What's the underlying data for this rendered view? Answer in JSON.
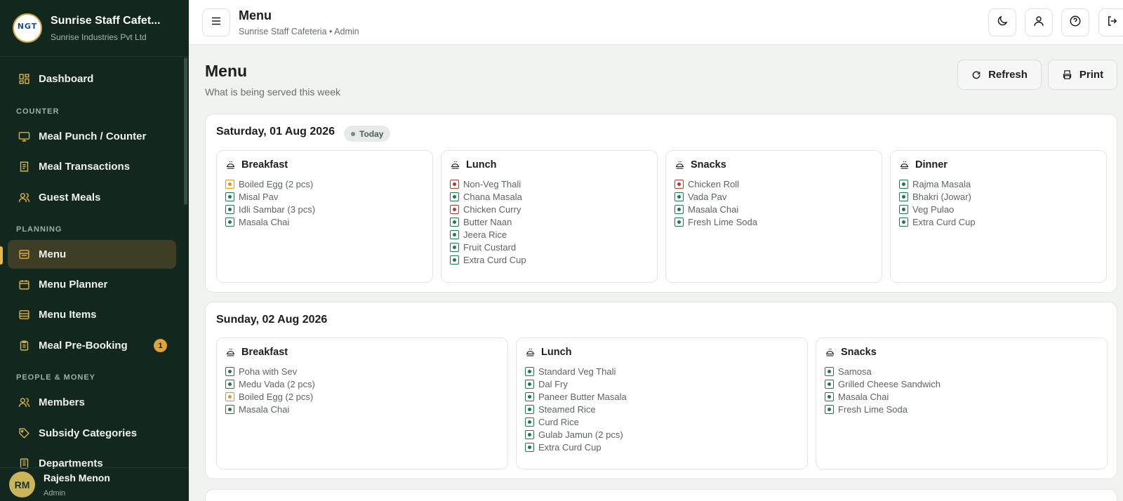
{
  "app": {
    "title": "Sunrise Staff Cafet...",
    "subtitle": "Sunrise Industries Pvt Ltd",
    "logo_text": "NGT"
  },
  "sidebar": {
    "dashboard": "Dashboard",
    "sections": {
      "counter": "COUNTER",
      "planning": "PLANNING",
      "people": "PEOPLE & MONEY"
    },
    "items": {
      "meal_punch": "Meal Punch / Counter",
      "meal_transactions": "Meal Transactions",
      "guest_meals": "Guest Meals",
      "menu": "Menu",
      "menu_planner": "Menu Planner",
      "menu_items": "Menu Items",
      "meal_prebooking": "Meal Pre-Booking",
      "members": "Members",
      "subsidy_categories": "Subsidy Categories",
      "departments": "Departments"
    },
    "prebooking_badge": "1"
  },
  "user": {
    "initials": "RM",
    "name": "Rajesh Menon",
    "role": "Admin"
  },
  "topbar": {
    "title": "Menu",
    "subtitle": "Sunrise Staff Cafeteria • Admin"
  },
  "page": {
    "title": "Menu",
    "subtitle": "What is being served this week",
    "refresh_label": "Refresh",
    "print_label": "Print"
  },
  "colors": {
    "veg": "#1f7a4a",
    "nonveg": "#b23a2e",
    "egg": "#d99a1c"
  },
  "days": [
    {
      "date": "Saturday, 01 Aug 2026",
      "badge": "Today",
      "meals": [
        {
          "name": "Breakfast",
          "items": [
            {
              "label": "Boiled Egg (2 pcs)",
              "type": "egg"
            },
            {
              "label": "Misal Pav",
              "type": "veg"
            },
            {
              "label": "Idli Sambar (3 pcs)",
              "type": "veg"
            },
            {
              "label": "Masala Chai",
              "type": "veg"
            }
          ]
        },
        {
          "name": "Lunch",
          "items": [
            {
              "label": "Non-Veg Thali",
              "type": "nonveg"
            },
            {
              "label": "Chana Masala",
              "type": "veg"
            },
            {
              "label": "Chicken Curry",
              "type": "nonveg"
            },
            {
              "label": "Butter Naan",
              "type": "veg"
            },
            {
              "label": "Jeera Rice",
              "type": "veg"
            },
            {
              "label": "Fruit Custard",
              "type": "veg"
            },
            {
              "label": "Extra Curd Cup",
              "type": "veg"
            }
          ]
        },
        {
          "name": "Snacks",
          "items": [
            {
              "label": "Chicken Roll",
              "type": "nonveg"
            },
            {
              "label": "Vada Pav",
              "type": "veg"
            },
            {
              "label": "Masala Chai",
              "type": "veg"
            },
            {
              "label": "Fresh Lime Soda",
              "type": "veg"
            }
          ]
        },
        {
          "name": "Dinner",
          "items": [
            {
              "label": "Rajma Masala",
              "type": "veg"
            },
            {
              "label": "Bhakri (Jowar)",
              "type": "veg"
            },
            {
              "label": "Veg Pulao",
              "type": "veg"
            },
            {
              "label": "Extra Curd Cup",
              "type": "veg"
            }
          ]
        }
      ]
    },
    {
      "date": "Sunday, 02 Aug 2026",
      "meals": [
        {
          "name": "Breakfast",
          "items": [
            {
              "label": "Poha with Sev",
              "type": "veg"
            },
            {
              "label": "Medu Vada (2 pcs)",
              "type": "veg"
            },
            {
              "label": "Boiled Egg (2 pcs)",
              "type": "egg"
            },
            {
              "label": "Masala Chai",
              "type": "veg"
            }
          ]
        },
        {
          "name": "Lunch",
          "items": [
            {
              "label": "Standard Veg Thali",
              "type": "veg"
            },
            {
              "label": "Dal Fry",
              "type": "veg"
            },
            {
              "label": "Paneer Butter Masala",
              "type": "veg"
            },
            {
              "label": "Steamed Rice",
              "type": "veg"
            },
            {
              "label": "Curd Rice",
              "type": "veg"
            },
            {
              "label": "Gulab Jamun (2 pcs)",
              "type": "veg"
            },
            {
              "label": "Extra Curd Cup",
              "type": "veg"
            }
          ]
        },
        {
          "name": "Snacks",
          "items": [
            {
              "label": "Samosa",
              "type": "veg"
            },
            {
              "label": "Grilled Cheese Sandwich",
              "type": "veg"
            },
            {
              "label": "Masala Chai",
              "type": "veg"
            },
            {
              "label": "Fresh Lime Soda",
              "type": "veg"
            }
          ]
        }
      ]
    }
  ]
}
